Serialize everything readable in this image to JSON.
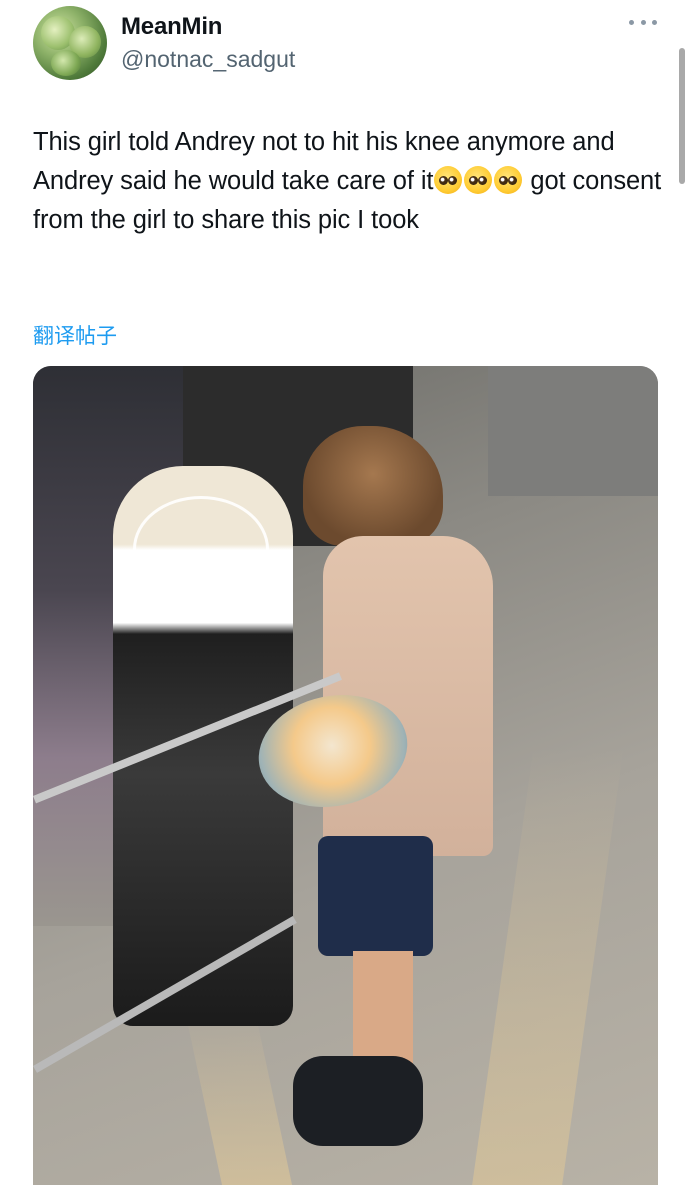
{
  "post": {
    "display_name": "MeanMin",
    "handle": "@notnac_sadgut",
    "text_part1": "This girl told Andrey not to hit his knee anymore and Andrey said he would take care of it",
    "text_part2": " got consent from the girl to share this pic I took",
    "emojis": [
      "pleading-face-emoji",
      "pleading-face-emoji",
      "pleading-face-emoji"
    ],
    "translate_label": "翻译帖子"
  },
  "colors": {
    "link": "#1d9bf0",
    "secondary_text": "#536471",
    "primary_text": "#0f1419"
  }
}
